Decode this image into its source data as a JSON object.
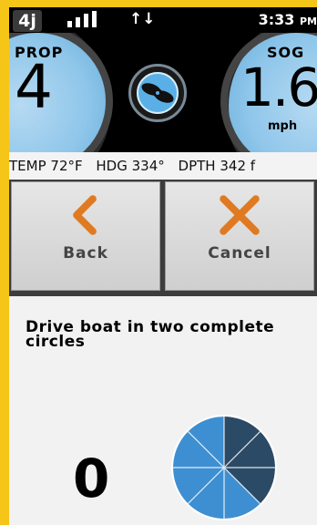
{
  "status": {
    "channel": "4j",
    "clock": "3:33",
    "ampm": "PM"
  },
  "gauges": {
    "prop": {
      "label": "PROP",
      "value": "4"
    },
    "sog": {
      "label": "SOG",
      "value": "1.6",
      "unit": "mph"
    }
  },
  "infobar": {
    "temp": "TEMP 72°F",
    "heading": "HDG 334°",
    "depth": "DPTH  342 f"
  },
  "buttons": {
    "back_label": "Back",
    "cancel_label": "Cancel"
  },
  "calibration": {
    "instruction": "Drive boat in two complete circles",
    "count": "0",
    "progress_fraction": 0.375
  },
  "colors": {
    "frame": "#f5c518",
    "accent_orange": "#e07a22",
    "gauge_blue": "#8fc6ea",
    "progress_dark": "#2b4a66",
    "progress_light": "#3d8fd1"
  }
}
